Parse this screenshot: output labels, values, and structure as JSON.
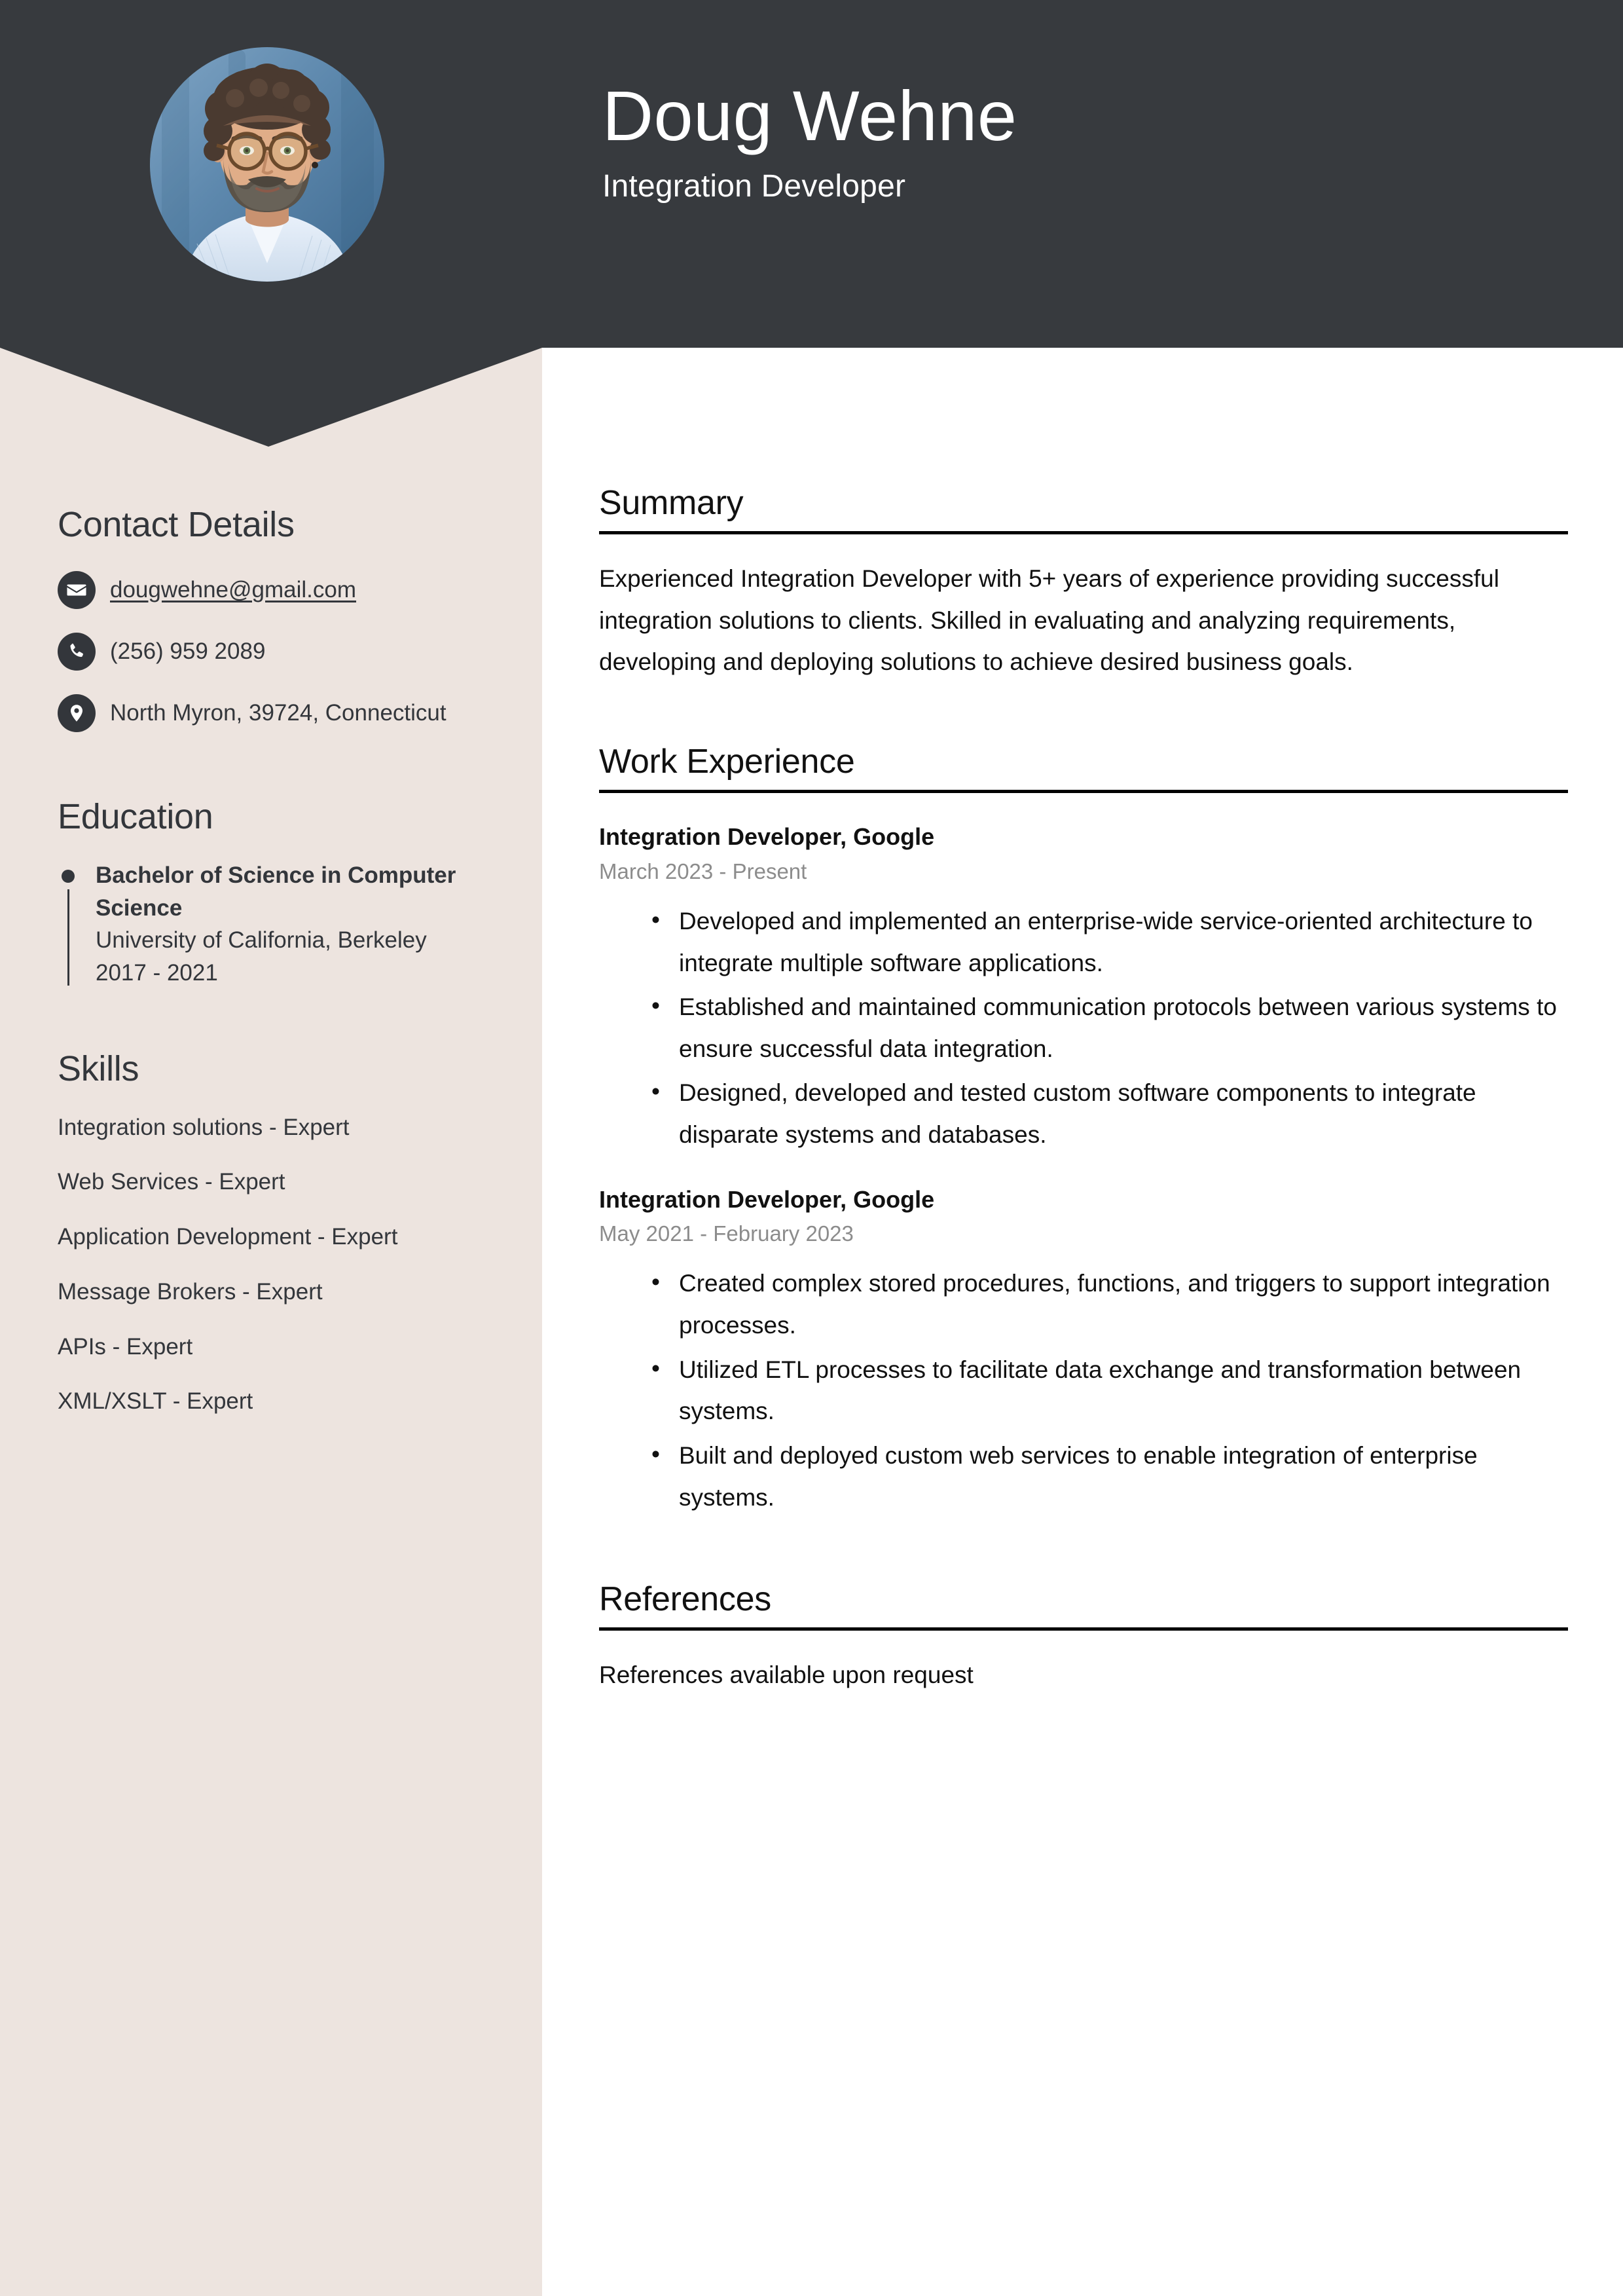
{
  "theme": {
    "header_bg": "#373A3E",
    "sidebar_bg": "#EDE4DF",
    "main_bg": "#FFFFFF",
    "text_dark": "#33363B",
    "muted_text": "#8C8C8C",
    "rule_color": "#000000"
  },
  "header": {
    "name": "Doug Wehne",
    "job_title": "Integration Developer",
    "avatar_alt": "profile-photo"
  },
  "sidebar": {
    "contact": {
      "heading": "Contact Details",
      "items": [
        {
          "icon": "envelope-icon",
          "value": "dougwehne@gmail.com",
          "is_link": true
        },
        {
          "icon": "phone-icon",
          "value": "(256) 959 2089",
          "is_link": false
        },
        {
          "icon": "location-pin-icon",
          "value": "North Myron, 39724, Connecticut",
          "is_link": false
        }
      ]
    },
    "education": {
      "heading": "Education",
      "items": [
        {
          "degree": "Bachelor of Science in Computer Science",
          "school": "University of California, Berkeley",
          "years": "2017 - 2021"
        }
      ]
    },
    "skills": {
      "heading": "Skills",
      "items": [
        "Integration solutions - Expert",
        "Web Services - Expert",
        "Application Development - Expert",
        "Message Brokers - Expert",
        "APIs - Expert",
        "XML/XSLT - Expert"
      ]
    }
  },
  "main": {
    "summary": {
      "heading": "Summary",
      "text": "Experienced Integration Developer with 5+ years of experience providing successful integration solutions to clients. Skilled in evaluating and analyzing requirements, developing and deploying solutions to achieve desired business goals."
    },
    "work_experience": {
      "heading": "Work Experience",
      "jobs": [
        {
          "title": "Integration Developer, Google",
          "dates": "March 2023 - Present",
          "bullets": [
            "Developed and implemented an enterprise-wide service-oriented architecture to integrate multiple software applications.",
            "Established and maintained communication protocols between various systems to ensure successful data integration.",
            "Designed, developed and tested custom software components to integrate disparate systems and databases."
          ]
        },
        {
          "title": "Integration Developer, Google",
          "dates": "May 2021 - February 2023",
          "bullets": [
            "Created complex stored procedures, functions, and triggers to support integration processes.",
            "Utilized ETL processes to facilitate data exchange and transformation between systems.",
            "Built and deployed custom web services to enable integration of enterprise systems."
          ]
        }
      ]
    },
    "references": {
      "heading": "References",
      "text": "References available upon request"
    }
  }
}
